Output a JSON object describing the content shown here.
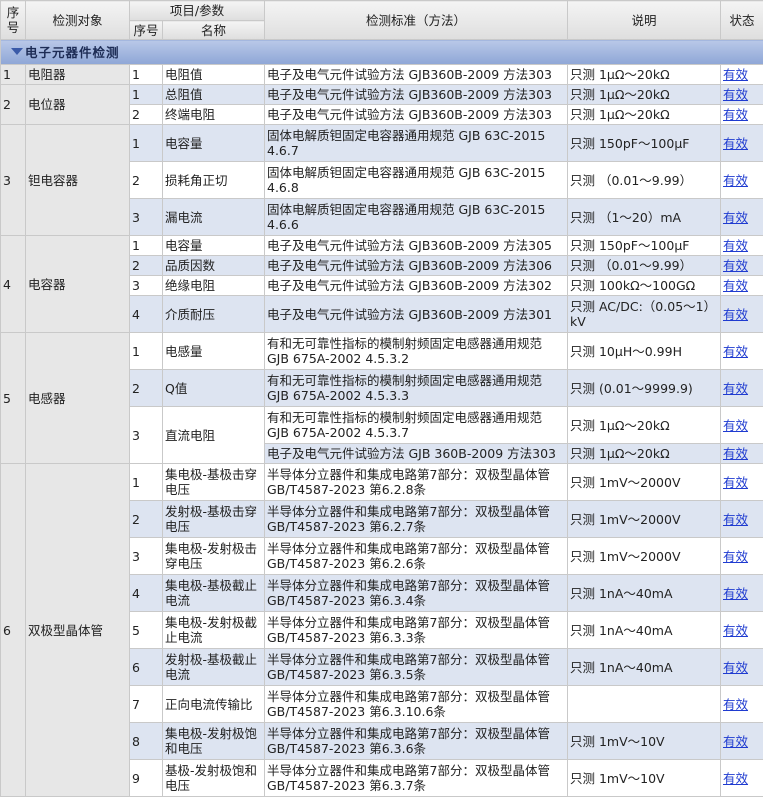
{
  "headers": {
    "seq": "序号",
    "object": "检测对象",
    "param_group": "项目/参数",
    "sub_seq": "序号",
    "name": "名称",
    "standard": "检测标准（方法）",
    "note": "说明",
    "status": "状态"
  },
  "section": {
    "title": "电子元器件检测"
  },
  "status_label": "有效",
  "groups": [
    {
      "seq": "1",
      "object": "电阻器",
      "items": [
        {
          "sub": "1",
          "name": "电阻值",
          "standard": "电子及电气元件试验方法 GJB360B-2009 方法303",
          "note": "只测 1μΩ～20kΩ"
        }
      ]
    },
    {
      "seq": "2",
      "object": "电位器",
      "items": [
        {
          "sub": "1",
          "name": "总阻值",
          "standard": "电子及电气元件试验方法 GJB360B-2009 方法303",
          "note": "只测 1μΩ～20kΩ"
        },
        {
          "sub": "2",
          "name": "终端电阻",
          "standard": "电子及电气元件试验方法 GJB360B-2009 方法303",
          "note": "只测 1μΩ～20kΩ"
        }
      ]
    },
    {
      "seq": "3",
      "object": "钽电容器",
      "items": [
        {
          "sub": "1",
          "name": "电容量",
          "standard": "固体电解质钽固定电容器通用规范 GJB 63C-2015 4.6.7",
          "note": "只测 150pF～100μF"
        },
        {
          "sub": "2",
          "name": "损耗角正切",
          "standard": "固体电解质钽固定电容器通用规范 GJB 63C-2015 4.6.8",
          "note": "只测 （0.01～9.99）"
        },
        {
          "sub": "3",
          "name": "漏电流",
          "standard": "固体电解质钽固定电容器通用规范 GJB 63C-2015 4.6.6",
          "note": "只测 （1～20）mA"
        }
      ]
    },
    {
      "seq": "4",
      "object": "电容器",
      "items": [
        {
          "sub": "1",
          "name": "电容量",
          "standard": "电子及电气元件试验方法 GJB360B-2009 方法305",
          "note": "只测 150pF～100μF"
        },
        {
          "sub": "2",
          "name": "品质因数",
          "standard": "电子及电气元件试验方法 GJB360B-2009 方法306",
          "note": "只测 （0.01～9.99）"
        },
        {
          "sub": "3",
          "name": "绝缘电阻",
          "standard": "电子及电气元件试验方法 GJB360B-2009 方法302",
          "note": "只测 100kΩ～100GΩ"
        },
        {
          "sub": "4",
          "name": "介质耐压",
          "standard": "电子及电气元件试验方法 GJB360B-2009 方法301",
          "note": "只测 AC/DC:（0.05～1）kV"
        }
      ]
    },
    {
      "seq": "5",
      "object": "电感器",
      "items": [
        {
          "sub": "1",
          "name": "电感量",
          "standard": "有和无可靠性指标的模制射频固定电感器通用规范 GJB 675A-2002 4.5.3.2",
          "note": "只测 10μH～0.99H"
        },
        {
          "sub": "2",
          "name": "Q值",
          "standard": "有和无可靠性指标的模制射频固定电感器通用规范 GJB 675A-2002 4.5.3.3",
          "note": "只测 (0.01～9999.9)"
        },
        {
          "sub": "3",
          "name": "直流电阻",
          "standard": "有和无可靠性指标的模制射频固定电感器通用规范 GJB 675A-2002 4.5.3.7",
          "note": "只测 1μΩ～20kΩ",
          "extra": {
            "standard": "电子及电气元件试验方法 GJB 360B-2009 方法303",
            "note": "只测 1μΩ～20kΩ"
          }
        }
      ]
    },
    {
      "seq": "6",
      "object": "双极型晶体管",
      "items": [
        {
          "sub": "1",
          "name": "集电极-基极击穿电压",
          "standard": "半导体分立器件和集成电路第7部分：双极型晶体管 GB/T4587-2023 第6.2.8条",
          "note": "只测 1mV～2000V"
        },
        {
          "sub": "2",
          "name": "发射极-基极击穿电压",
          "standard": "半导体分立器件和集成电路第7部分：双极型晶体管 GB/T4587-2023 第6.2.7条",
          "note": "只测 1mV～2000V"
        },
        {
          "sub": "3",
          "name": "集电极-发射极击穿电压",
          "standard": "半导体分立器件和集成电路第7部分：双极型晶体管 GB/T4587-2023 第6.2.6条",
          "note": "只测 1mV～2000V"
        },
        {
          "sub": "4",
          "name": "集电极-基极截止电流",
          "standard": "半导体分立器件和集成电路第7部分：双极型晶体管 GB/T4587-2023 第6.3.4条",
          "note": "只测 1nA～40mA"
        },
        {
          "sub": "5",
          "name": "集电极-发射极截止电流",
          "standard": "半导体分立器件和集成电路第7部分：双极型晶体管 GB/T4587-2023 第6.3.3条",
          "note": "只测 1nA～40mA"
        },
        {
          "sub": "6",
          "name": "发射极-基极截止电流",
          "standard": "半导体分立器件和集成电路第7部分：双极型晶体管 GB/T4587-2023 第6.3.5条",
          "note": "只测 1nA～40mA"
        },
        {
          "sub": "7",
          "name": "正向电流传输比",
          "standard": "半导体分立器件和集成电路第7部分：双极型晶体管 GB/T4587-2023 第6.3.10.6条",
          "note": ""
        },
        {
          "sub": "8",
          "name": "集电极-发射极饱和电压",
          "standard": "半导体分立器件和集成电路第7部分：双极型晶体管 GB/T4587-2023 第6.3.6条",
          "note": "只测 1mV～10V"
        },
        {
          "sub": "9",
          "name": "基极-发射极饱和电压",
          "standard": "半导体分立器件和集成电路第7部分：双极型晶体管 GB/T4587-2023 第6.3.7条",
          "note": "只测 1mV～10V"
        }
      ]
    }
  ]
}
